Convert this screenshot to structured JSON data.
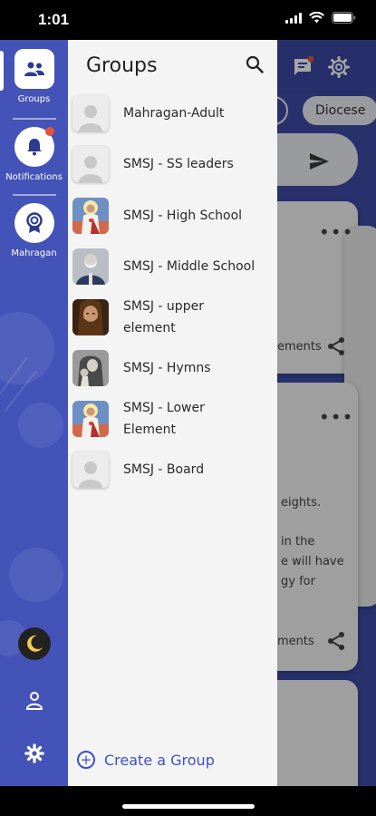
{
  "status_bar": {
    "time": "1:01"
  },
  "background": {
    "chips": [
      "Diocese"
    ],
    "card1_text": "ements",
    "card2_lines": [
      "eights.",
      "in the",
      "e will have",
      "gy for"
    ],
    "card2_footer": "ments"
  },
  "rail": {
    "items": [
      {
        "label": "Groups",
        "icon": "groups-icon"
      },
      {
        "label": "Notifications",
        "icon": "bell-icon"
      },
      {
        "label": "Mahragan",
        "icon": "award-icon"
      }
    ],
    "bottom_icons": [
      "moon-icon",
      "person-icon",
      "gear-icon"
    ]
  },
  "drawer": {
    "title": "Groups",
    "groups": [
      {
        "name": "Mahragan-Adult",
        "avatar": "placeholder"
      },
      {
        "name": "SMSJ - SS leaders",
        "avatar": "placeholder"
      },
      {
        "name": "SMSJ - High School",
        "avatar": "sacred-heart"
      },
      {
        "name": "SMSJ - Middle School",
        "avatar": "saint"
      },
      {
        "name": "SMSJ - upper element",
        "avatar": "christ-portrait"
      },
      {
        "name": "SMSJ - Hymns",
        "avatar": "icon-mother"
      },
      {
        "name": "SMSJ - Lower Element",
        "avatar": "sacred-heart"
      },
      {
        "name": "SMSJ - Board",
        "avatar": "placeholder"
      }
    ],
    "create_label": "Create a Group"
  },
  "colors": {
    "rail": "#4453b8",
    "accent": "#3d50c7",
    "drawer_bg": "#f4f4f4",
    "notification_dot": "#e5533c"
  }
}
